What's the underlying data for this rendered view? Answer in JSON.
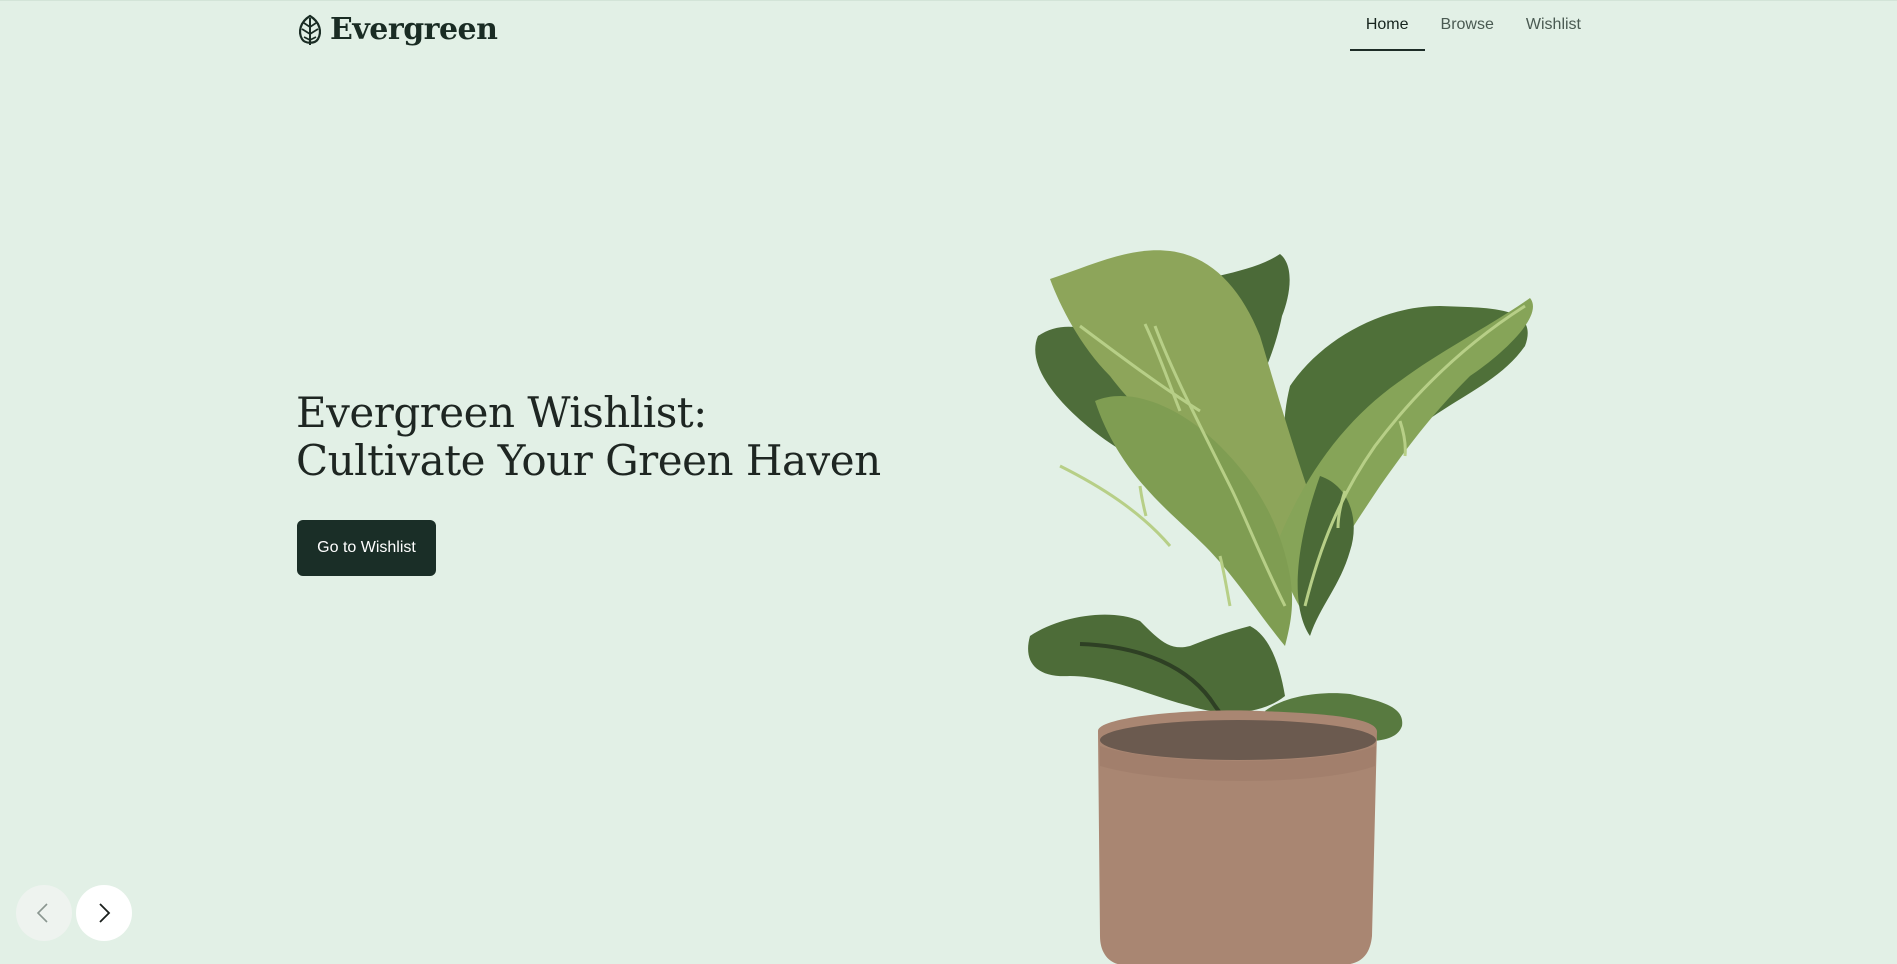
{
  "brand": {
    "name": "Evergreen",
    "logo_icon": "leaf-icon"
  },
  "nav": {
    "items": [
      {
        "label": "Home",
        "active": true
      },
      {
        "label": "Browse",
        "active": false
      },
      {
        "label": "Wishlist",
        "active": false
      }
    ]
  },
  "hero": {
    "title_line1": "Evergreen Wishlist:",
    "title_line2": "Cultivate Your Green Haven",
    "cta_label": "Go to Wishlist",
    "image": "potted-fiddle-leaf-fig-illustration"
  },
  "carousel": {
    "prev_icon": "chevron-left-icon",
    "next_icon": "chevron-right-icon"
  },
  "colors": {
    "background": "#e2f0e6",
    "primary_dark": "#1a2e27",
    "text": "#1e2622",
    "leaf_dark": "#4a6b37",
    "leaf_light": "#8aa85a",
    "pot": "#a98672"
  }
}
